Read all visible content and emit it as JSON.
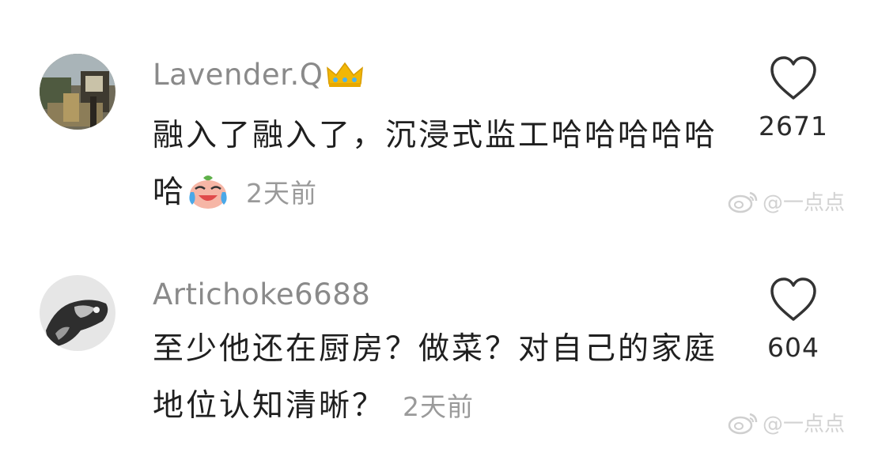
{
  "comments": [
    {
      "username": "Lavender.Q",
      "badge_icon": "crown-icon",
      "text": "融入了融入了，沉浸式监工哈哈哈哈哈哈",
      "emoji_icon": "crying-laughing-emoji-icon",
      "timestamp": "2天前",
      "likes": "2671",
      "watermark": "@一点点"
    },
    {
      "username": "Artichoke6688",
      "text": "至少他还在厨房？做菜？对自己的家庭地位认知清晰？",
      "timestamp": "2天前",
      "likes": "604",
      "watermark": "@一点点"
    }
  ],
  "colors": {
    "username": "#8a8a8a",
    "body_text": "#1f1f1f",
    "timestamp": "#9a9a9a",
    "like_count": "#2a2a2a",
    "watermark": "#d2d2d2",
    "crown": "#f2b705"
  }
}
